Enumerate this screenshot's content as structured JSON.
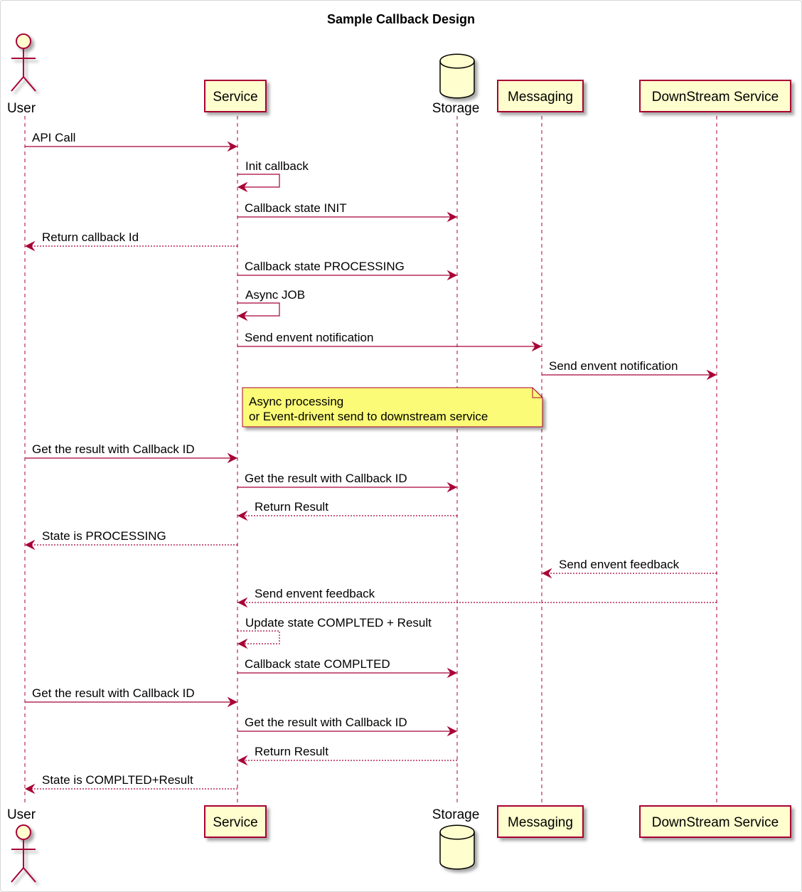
{
  "diagram": {
    "title": "Sample Callback Design",
    "colors": {
      "line": "#a80036",
      "participant_fill": "#fefece",
      "note_fill": "#fbfb77",
      "text": "#000000"
    },
    "participants": [
      {
        "id": "user",
        "label": "User",
        "kind": "actor"
      },
      {
        "id": "service",
        "label": "Service",
        "kind": "participant"
      },
      {
        "id": "storage",
        "label": "Storage",
        "kind": "database"
      },
      {
        "id": "messaging",
        "label": "Messaging",
        "kind": "participant"
      },
      {
        "id": "downstream",
        "label": "DownStream Service",
        "kind": "participant"
      }
    ],
    "messages": [
      {
        "from": "user",
        "to": "service",
        "label": "API Call",
        "style": "solid"
      },
      {
        "from": "service",
        "to": "service",
        "label": "Init callback",
        "style": "solid"
      },
      {
        "from": "service",
        "to": "storage",
        "label": "Callback state INIT",
        "style": "solid"
      },
      {
        "from": "service",
        "to": "user",
        "label": "Return callback Id",
        "style": "dashed"
      },
      {
        "from": "service",
        "to": "storage",
        "label": "Callback state PROCESSING",
        "style": "solid"
      },
      {
        "from": "service",
        "to": "service",
        "label": "Async JOB",
        "style": "solid"
      },
      {
        "from": "service",
        "to": "messaging",
        "label": "Send envent notification",
        "style": "solid"
      },
      {
        "from": "messaging",
        "to": "downstream",
        "label": "Send envent notification",
        "style": "solid"
      },
      {
        "note": true,
        "lines": [
          "Async processing",
          "or Event-drivent send to downstream service"
        ]
      },
      {
        "from": "user",
        "to": "service",
        "label": "Get the result with Callback ID",
        "style": "solid"
      },
      {
        "from": "service",
        "to": "storage",
        "label": "Get the result with Callback ID",
        "style": "solid"
      },
      {
        "from": "storage",
        "to": "service",
        "label": "Return Result",
        "style": "dashed"
      },
      {
        "from": "service",
        "to": "user",
        "label": "State is PROCESSING",
        "style": "dashed"
      },
      {
        "from": "downstream",
        "to": "messaging",
        "label": "Send envent feedback",
        "style": "dashed"
      },
      {
        "from": "downstream",
        "to": "service",
        "label": "Send envent feedback",
        "style": "dashed"
      },
      {
        "from": "service",
        "to": "service",
        "label": "Update state COMPLTED + Result",
        "style": "dashed"
      },
      {
        "from": "service",
        "to": "storage",
        "label": "Callback state COMPLTED",
        "style": "solid"
      },
      {
        "from": "user",
        "to": "service",
        "label": "Get the result with Callback ID",
        "style": "solid"
      },
      {
        "from": "service",
        "to": "storage",
        "label": "Get the result with Callback ID",
        "style": "solid"
      },
      {
        "from": "storage",
        "to": "service",
        "label": "Return Result",
        "style": "dashed"
      },
      {
        "from": "service",
        "to": "user",
        "label": "State is COMPLTED+Result",
        "style": "dashed"
      }
    ]
  }
}
